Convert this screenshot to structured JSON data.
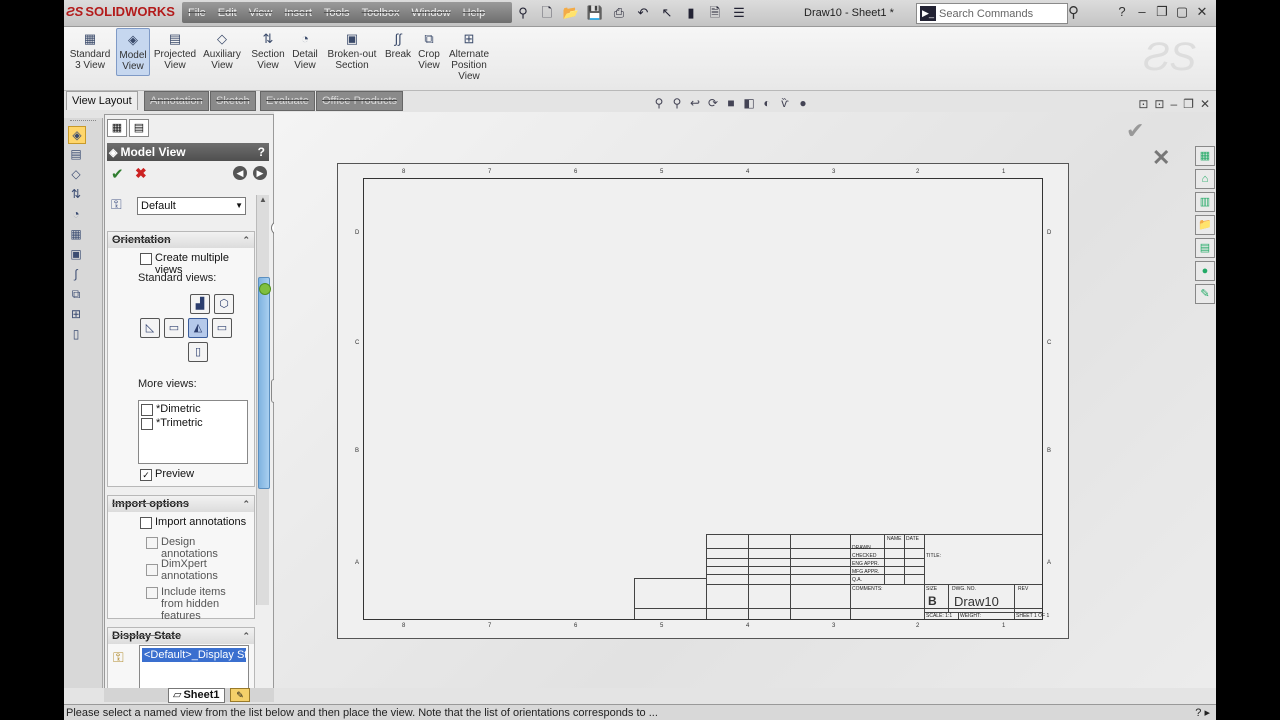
{
  "titlebar": {
    "app_name": "SOLIDWORKS",
    "menus": [
      "File",
      "Edit",
      "View",
      "Insert",
      "Tools",
      "Toolbox",
      "Window",
      "Help"
    ],
    "document_title": "Draw10 - Sheet1 *",
    "search_placeholder": "Search Commands"
  },
  "ribbon": {
    "buttons": [
      {
        "label": "Standard 3 View",
        "icon": "standard-3-view-icon",
        "glyph": "▦"
      },
      {
        "label": "Model View",
        "icon": "model-view-icon",
        "glyph": "◈",
        "active": true
      },
      {
        "label": "Projected View",
        "icon": "projected-view-icon",
        "glyph": "▤"
      },
      {
        "label": "Auxiliary View",
        "icon": "auxiliary-view-icon",
        "glyph": "◇"
      },
      {
        "label": "Section View",
        "icon": "section-view-icon",
        "glyph": "⇅"
      },
      {
        "label": "Detail View",
        "icon": "detail-view-icon",
        "glyph": "◔"
      },
      {
        "label": "Broken-out Section",
        "icon": "broken-out-section-icon",
        "glyph": "▣"
      },
      {
        "label": "Break",
        "icon": "break-icon",
        "glyph": "∫∫"
      },
      {
        "label": "Crop View",
        "icon": "crop-view-icon",
        "glyph": "⧉"
      },
      {
        "label": "Alternate Position View",
        "icon": "alternate-position-view-icon",
        "glyph": "⊞"
      }
    ]
  },
  "tabs": [
    "View Layout",
    "Annotation",
    "Sketch",
    "Evaluate",
    "Office Products"
  ],
  "panel": {
    "title": "Model View",
    "help": "?",
    "named_view": "Default",
    "orientation": {
      "header": "Orientation",
      "create_multiple_views": "Create multiple views",
      "standard_views_label": "Standard views:",
      "more_views_label": "More views:",
      "more_views": [
        "*Dimetric",
        "*Trimetric"
      ],
      "preview": "Preview"
    },
    "import_options": {
      "header": "Import options",
      "import_annotations": "Import annotations",
      "design_annotations": "Design annotations",
      "dimxpert_annotations": "DimXpert annotations",
      "include_hidden": "Include items from hidden features"
    },
    "display_state": {
      "header": "Display State",
      "selected": "<Default>_Display Stat"
    }
  },
  "drawing": {
    "top_ticks": [
      "8",
      "7",
      "6",
      "5",
      "4",
      "3",
      "2",
      "1"
    ],
    "side_ticks": [
      "D",
      "C",
      "B",
      "A"
    ],
    "title_block": {
      "size_label": "SIZE",
      "dwg_no_label": "DWG. NO.",
      "rev_label": "REV",
      "size": "B",
      "dwg_no": "Draw10",
      "scale": "SCALE: 1:1",
      "weight": "WEIGHT:",
      "sheet": "SHEET 1 OF 1",
      "title_label": "TITLE:",
      "name_label": "NAME",
      "date_label": "DATE",
      "rows": [
        "DRAWN",
        "CHECKED",
        "ENG APPR.",
        "MFG APPR.",
        "Q.A.",
        "COMMENTS:"
      ]
    }
  },
  "sheet_tab": "Sheet1",
  "status_text": "Please select a named view from the list below and then place the view.  Note that the list of orientations corresponds to ...",
  "colors": {
    "accent": "#3a6fcf",
    "scroll_thumb": "#7fb3e0"
  }
}
